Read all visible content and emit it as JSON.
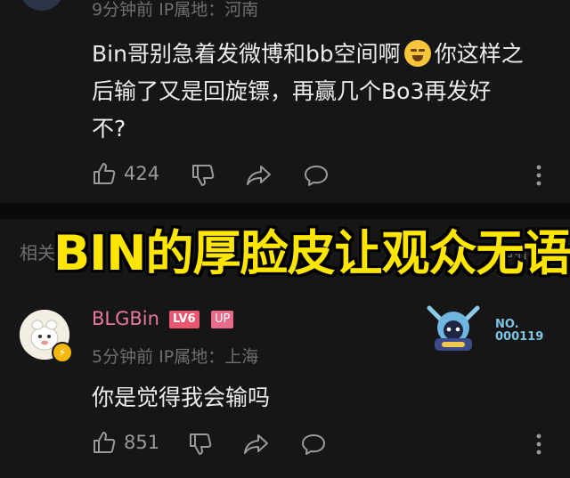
{
  "top_comment": {
    "meta": "9分钟前 IP属地：河南",
    "text_line1_before": "Bin哥别急着发微博和bb空间啊",
    "text_line1_after": "你这样之",
    "text_line2": "后输了又是回旋镖，再赢几个Bo3再发好",
    "text_line3": "不?",
    "like_count": "424"
  },
  "related": {
    "left_label": "相关",
    "right_label": "时间"
  },
  "headline": "BIN的厚脸皮让观众无语",
  "bottom_comment": {
    "username": "BLGBin",
    "level_badge": "LV6",
    "up_badge": "UP",
    "meta": "5分钟前 IP属地：上海",
    "text": "你是觉得我会输吗",
    "like_count": "851",
    "fan_number_label": "NO.",
    "fan_number": "000119"
  },
  "icons": {
    "like": "thumbs-up-icon",
    "dislike": "thumbs-down-icon",
    "share": "share-icon",
    "reply": "comment-icon",
    "more": "more-vertical-icon"
  },
  "colors": {
    "background": "#161616",
    "username": "#e8799b",
    "headline": "#ffe600",
    "badge": "#e8576f"
  }
}
